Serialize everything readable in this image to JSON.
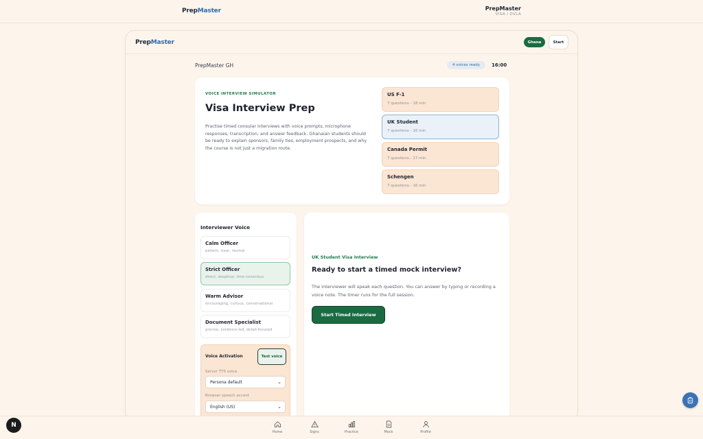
{
  "topbar": {
    "brand_a": "Prep",
    "brand_b": "Master",
    "right_title": "PrepMaster",
    "right_sub": "VISA / DVLA"
  },
  "frame": {
    "brand_a": "Prep",
    "brand_b": "Master",
    "ghana_label": "Ghana",
    "start_label": "Start",
    "subheader_title": "PrepMaster GH",
    "voices_ready": "4 voices ready",
    "timer": "16:00"
  },
  "hero": {
    "eyebrow": "VOICE INTERVIEW SIMULATOR",
    "title": "Visa Interview Prep",
    "description": "Practise timed consular interviews with voice prompts, microphone responses, transcription, and answer feedback. Ghanaian students should be ready to explain sponsors, family ties, employment prospects, and why the course is not just a migration route.",
    "visas": [
      {
        "title": "US F-1",
        "meta": "7 questions - 18 min",
        "selected": false
      },
      {
        "title": "UK Student",
        "meta": "7 questions - 16 min",
        "selected": true
      },
      {
        "title": "Canada Permit",
        "meta": "7 questions - 17 min",
        "selected": false
      },
      {
        "title": "Schengen",
        "meta": "7 questions - 16 min",
        "selected": false
      }
    ]
  },
  "voice": {
    "title": "Interviewer Voice",
    "options": [
      {
        "title": "Calm Officer",
        "desc": "patient, clear, neutral",
        "selected": false
      },
      {
        "title": "Strict Officer",
        "desc": "direct, skeptical, time-conscious",
        "selected": true
      },
      {
        "title": "Warm Advisor",
        "desc": "encouraging, curious, conversational",
        "selected": false
      },
      {
        "title": "Document Specialist",
        "desc": "precise, evidence-led, detail-focused",
        "selected": false
      }
    ],
    "activation_title": "Voice Activation",
    "test_label": "Test voice",
    "server_label": "Server TTS voice",
    "server_value": "Persona default",
    "browser_label": "Browser speech accent",
    "browser_value": "English (US)"
  },
  "interview": {
    "eyebrow": "UK Student Visa Interview",
    "title": "Ready to start a timed mock interview?",
    "text": "The interviewer will speak each question. You can answer by typing or recording a voice note. The timer runs for the full session.",
    "button": "Start Timed Interview"
  },
  "nav": [
    {
      "label": "Home",
      "icon": "home-icon"
    },
    {
      "label": "Signs",
      "icon": "warning-sign-icon"
    },
    {
      "label": "Practice",
      "icon": "bar-chart-icon"
    },
    {
      "label": "Mock",
      "icon": "document-icon"
    },
    {
      "label": "Profile",
      "icon": "user-icon"
    }
  ],
  "misc": {
    "badge_letter": "N"
  },
  "colors": {
    "accent_green": "#1b6b42",
    "accent_blue": "#2c6cb0",
    "background": "#fdf5ec",
    "card_peach": "#fbe5d3"
  }
}
